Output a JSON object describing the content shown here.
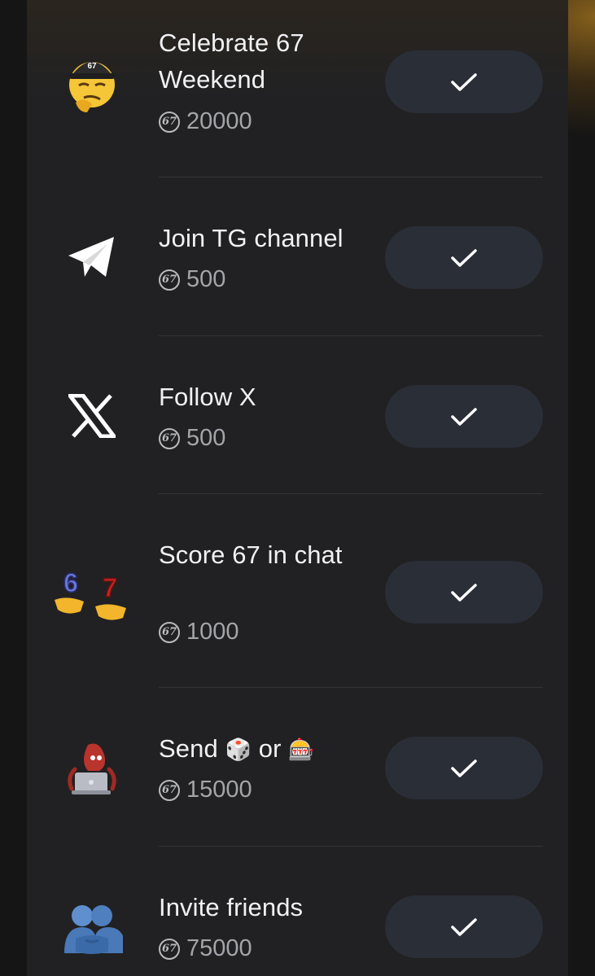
{
  "tasks": [
    {
      "icon": "thinking-face-cap-icon",
      "title": "Celebrate 67 Weekend",
      "reward": "20000",
      "status_icon": "check-icon"
    },
    {
      "icon": "telegram-icon",
      "title": "Join TG channel",
      "reward": "500",
      "status_icon": "check-icon"
    },
    {
      "icon": "x-logo-icon",
      "title": "Follow X",
      "reward": "500",
      "status_icon": "check-icon"
    },
    {
      "icon": "six-seven-hands-icon",
      "title": "Score 67 in chat",
      "reward": "1000",
      "status_icon": "check-icon"
    },
    {
      "icon": "squid-laptop-icon",
      "title_parts": [
        "Send",
        "🎲",
        "or",
        "🎰"
      ],
      "reward": "15000",
      "status_icon": "check-icon"
    },
    {
      "icon": "friends-icon",
      "title": "Invite friends",
      "reward": "75000",
      "status_icon": "check-icon"
    }
  ],
  "coin_mark": "67",
  "colors": {
    "panel": "#212123",
    "button": "#2a2e37",
    "text": "#f1f1f3",
    "reward_text": "#a4a5aa",
    "accent_glow": "#aa781e"
  }
}
